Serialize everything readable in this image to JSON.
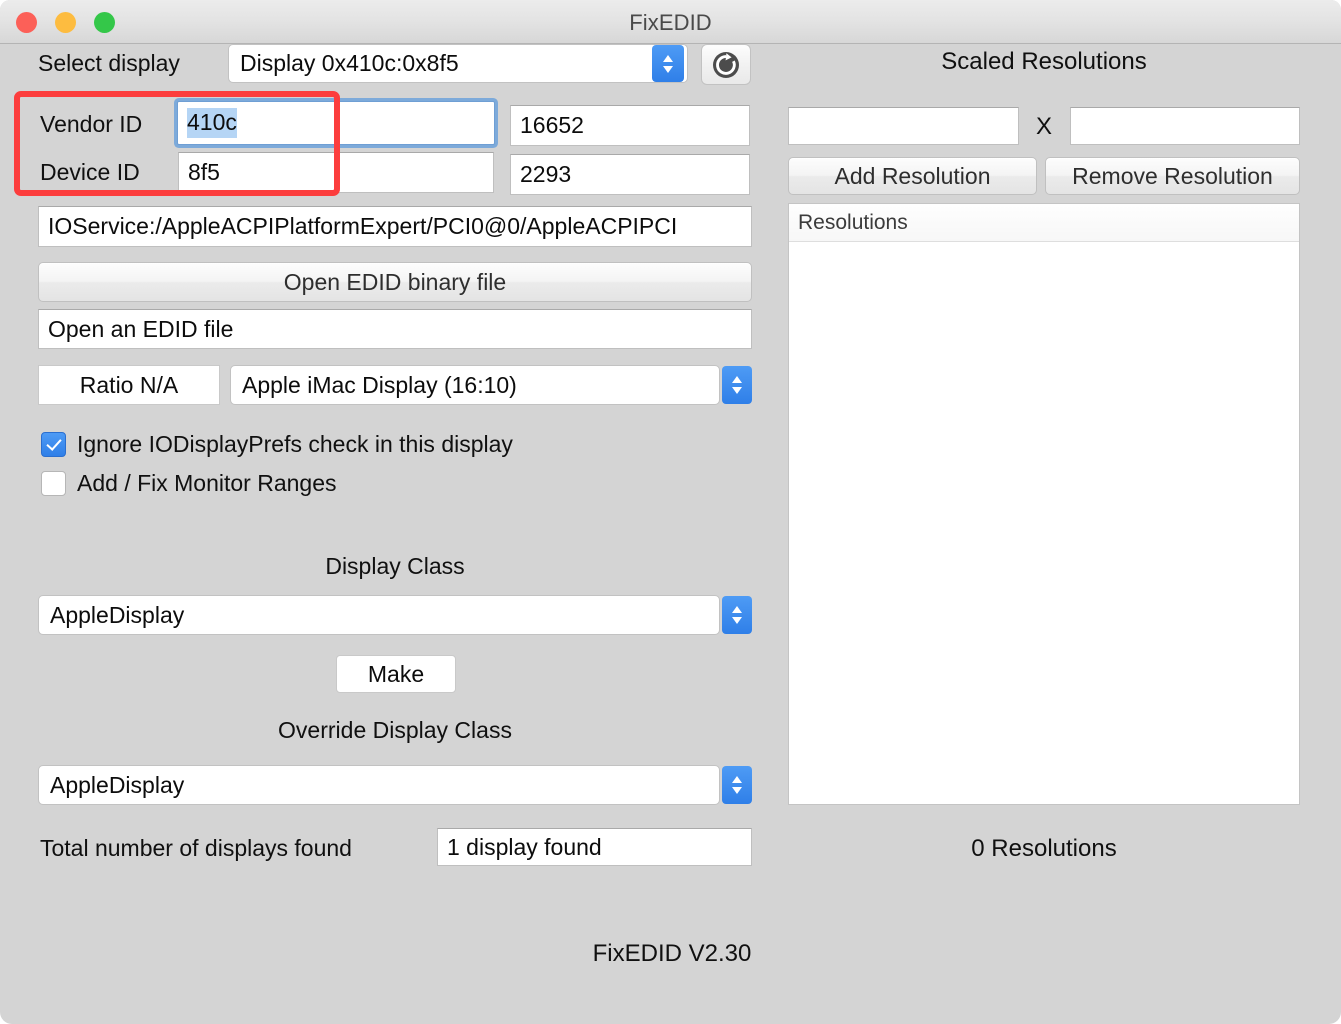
{
  "window": {
    "title": "FixEDID",
    "traffic_lights": {
      "close": "close-button",
      "minimize": "minimize-button",
      "zoom": "zoom-button"
    },
    "colors": {
      "close": "#fc6058",
      "minimize": "#fdbc40",
      "zoom": "#34c749",
      "accent_blue": "#2f7fe8",
      "selection_blue": "#b5d5f5",
      "annotation_red": "#fc3d3d",
      "window_bg": "#d4d4d4",
      "titlebar_bg": "#e7e7e7"
    }
  },
  "left": {
    "select_display_label": "Select display",
    "display_popup_value": "Display 0x410c:0x8f5",
    "refresh_icon": "refresh-icon",
    "vendor_id_label": "Vendor ID",
    "vendor_id_value": "410c",
    "vendor_id_decimal": "16652",
    "device_id_label": "Device ID",
    "device_id_value": "8f5",
    "device_id_decimal": "2293",
    "io_service_path": "IOService:/AppleACPIPlatformExpert/PCI0@0/AppleACPIPCI",
    "open_edid_binary_button": "Open EDID binary file",
    "open_edid_file_field": "Open an EDID file",
    "ratio_button": "Ratio N/A",
    "display_model_popup": "Apple iMac Display (16:10)",
    "checkbox_ignore_label": "Ignore IODisplayPrefs check in this display",
    "checkbox_ignore_checked": true,
    "checkbox_ranges_label": "Add / Fix Monitor Ranges",
    "checkbox_ranges_checked": false,
    "display_class_heading": "Display Class",
    "display_class_value": "AppleDisplay",
    "make_button": "Make",
    "override_display_class_heading": "Override Display Class",
    "override_display_class_value": "AppleDisplay",
    "total_displays_label": "Total number of displays found",
    "total_displays_value": "1 display found"
  },
  "right": {
    "heading": "Scaled Resolutions",
    "width_field_value": "",
    "height_field_value": "",
    "x_separator": "X",
    "add_resolution_button": "Add Resolution",
    "remove_resolution_button": "Remove Resolution",
    "resolutions_column_header": "Resolutions",
    "resolutions_rows": [],
    "resolutions_count_label": "0 Resolutions"
  },
  "footer": {
    "version": "FixEDID V2.30"
  }
}
